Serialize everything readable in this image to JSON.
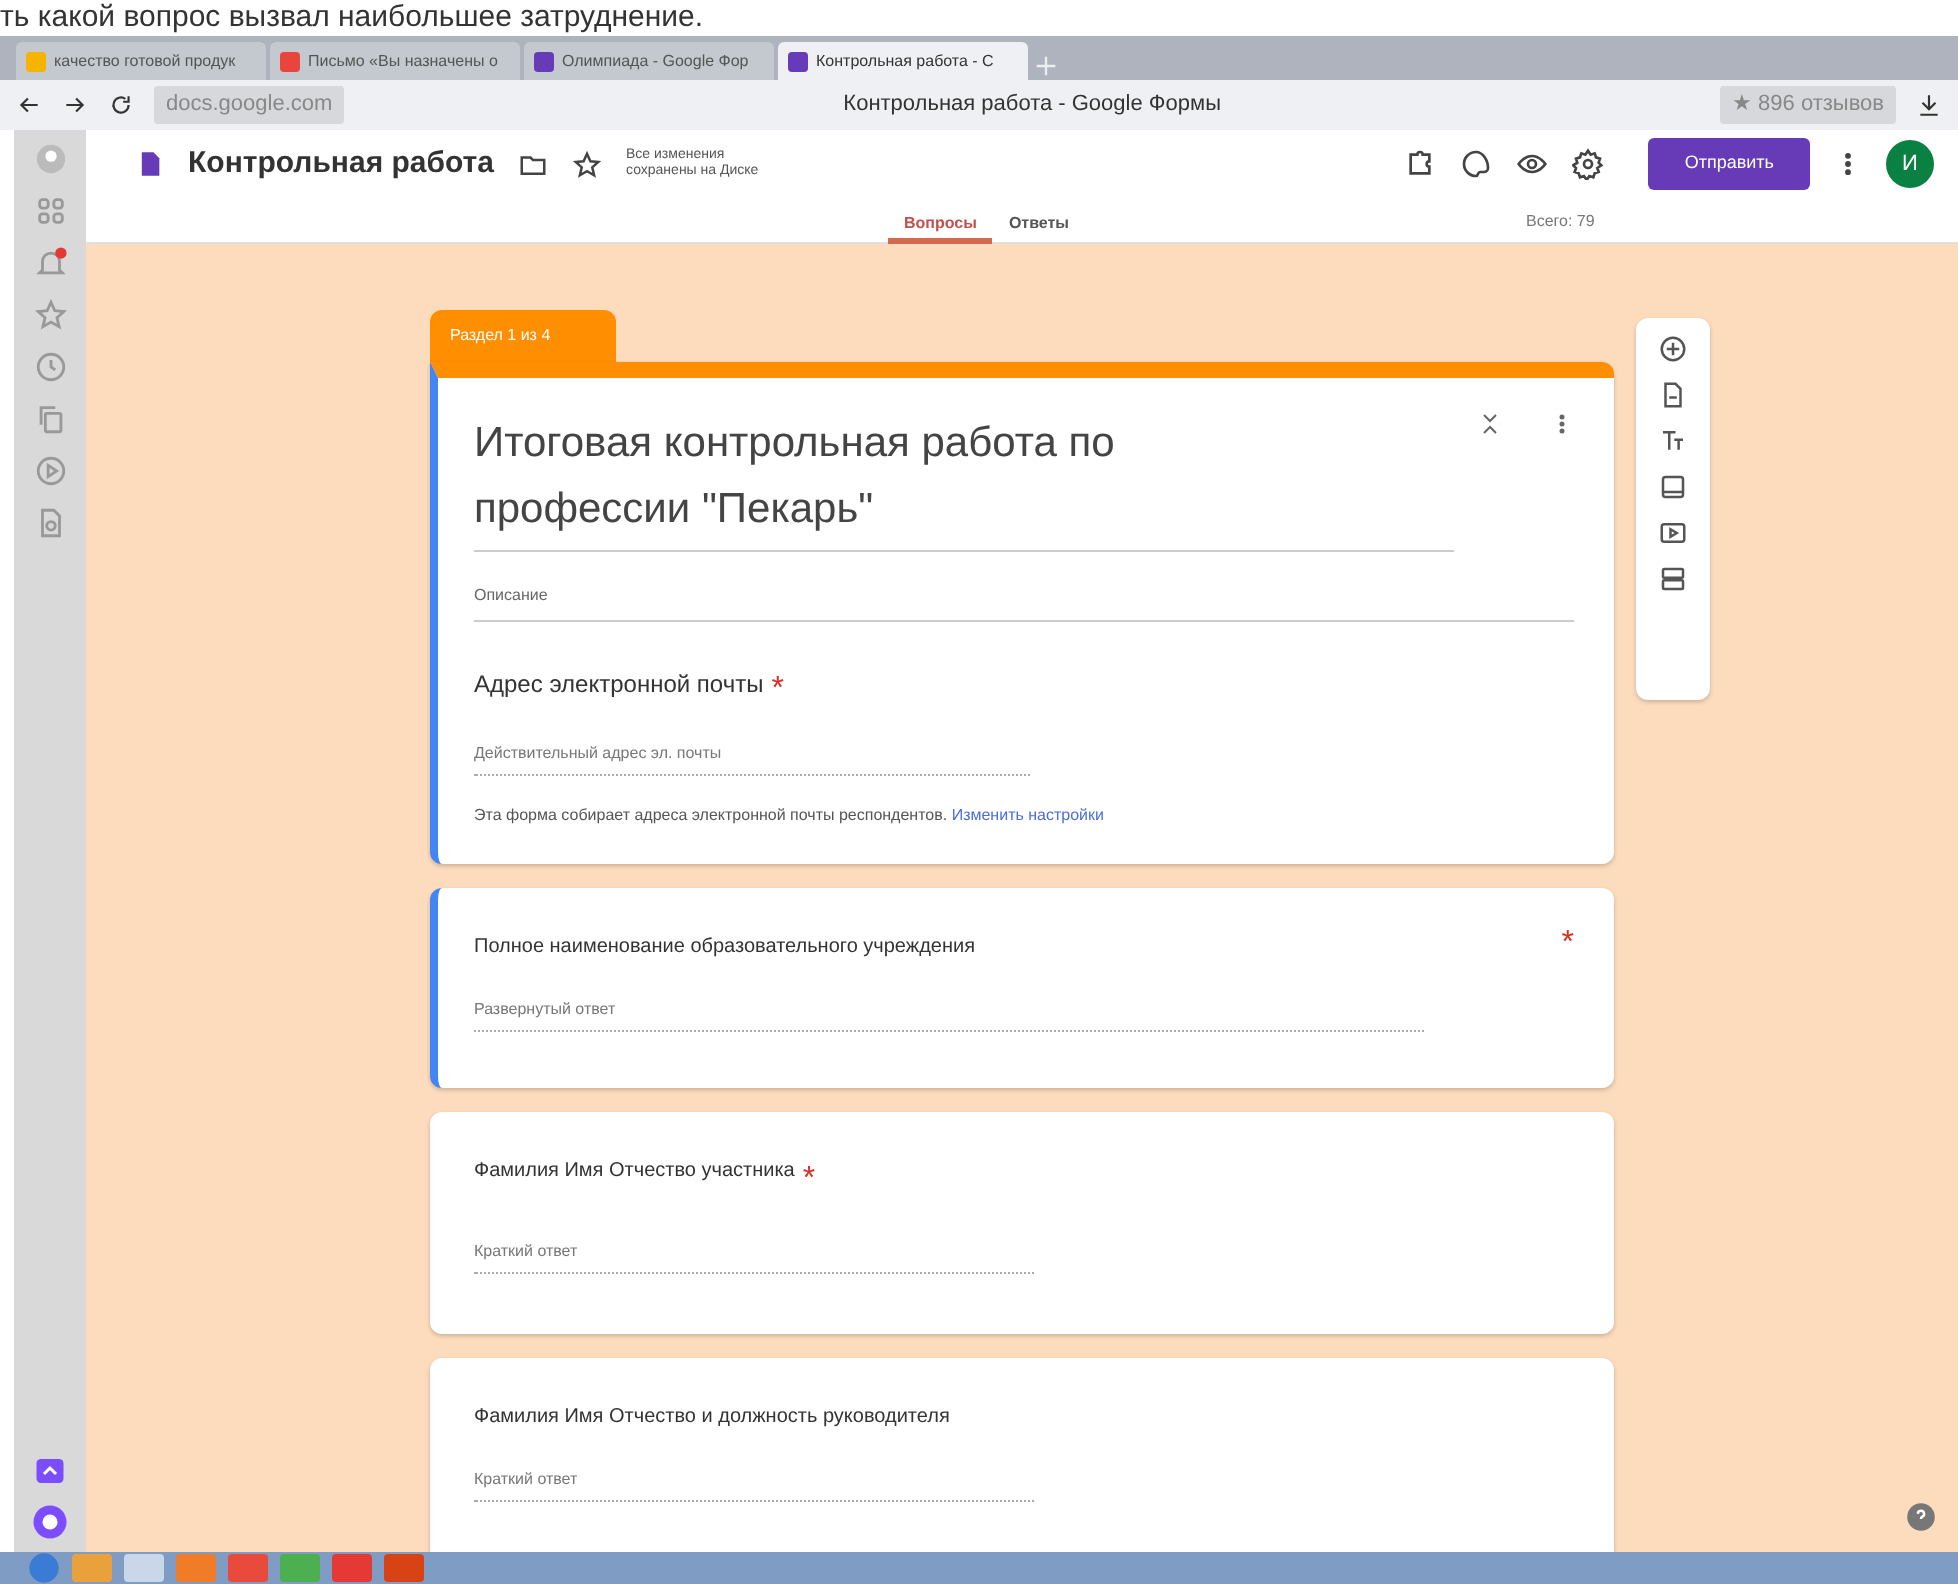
{
  "caption_above": "ть какой вопрос вызвал наибольшее затруднение.",
  "browser": {
    "tabs": [
      {
        "label": "качество готовой продук",
        "selected": false,
        "color": "#f4b400"
      },
      {
        "label": "Письмо «Вы назначены о",
        "selected": false,
        "color": "#e8453c"
      },
      {
        "label": "Олимпиада - Google Фор",
        "selected": false,
        "color": "#673ab7"
      },
      {
        "label": "Контрольная работа - С",
        "selected": true,
        "color": "#673ab7"
      }
    ],
    "address": "docs.google.com",
    "page_title": "Контрольная работа - Google Формы",
    "rating": "★ 896 отзывов"
  },
  "form_header": {
    "title": "Контрольная работа",
    "save_status": "Все изменения сохранены на Диске",
    "send_button": "Отправить",
    "avatar": "И",
    "tabs": [
      {
        "label": "Вопросы",
        "selected": true
      },
      {
        "label": "Ответы",
        "selected": false
      }
    ],
    "total": "Всего: 79"
  },
  "section_tag": "Раздел 1 из 4",
  "header_card": {
    "selected": true,
    "title": "Итоговая контрольная работа по профессии \"Пекарь\"",
    "description_placeholder": "Описание",
    "email_label": "Адрес электронной почты",
    "email_required_mark": "*",
    "email_placeholder": "Действительный адрес эл. почты",
    "note": "Эта форма собирает адреса электронной почты респондентов.",
    "note_link": "Изменить настройки"
  },
  "questions": [
    {
      "title": "Полное наименование образовательного учреждения",
      "required_mark": "*",
      "selected": true,
      "kind": "paragraph",
      "placeholder": "Развернутый ответ"
    },
    {
      "title": "Фамилия Имя Отчество участника",
      "required_mark": "*",
      "selected": false,
      "kind": "short",
      "placeholder": "Краткий ответ"
    },
    {
      "title": "Фамилия Имя Отчество и должность руководителя",
      "selected": false,
      "kind": "short",
      "placeholder": "Краткий ответ"
    }
  ]
}
